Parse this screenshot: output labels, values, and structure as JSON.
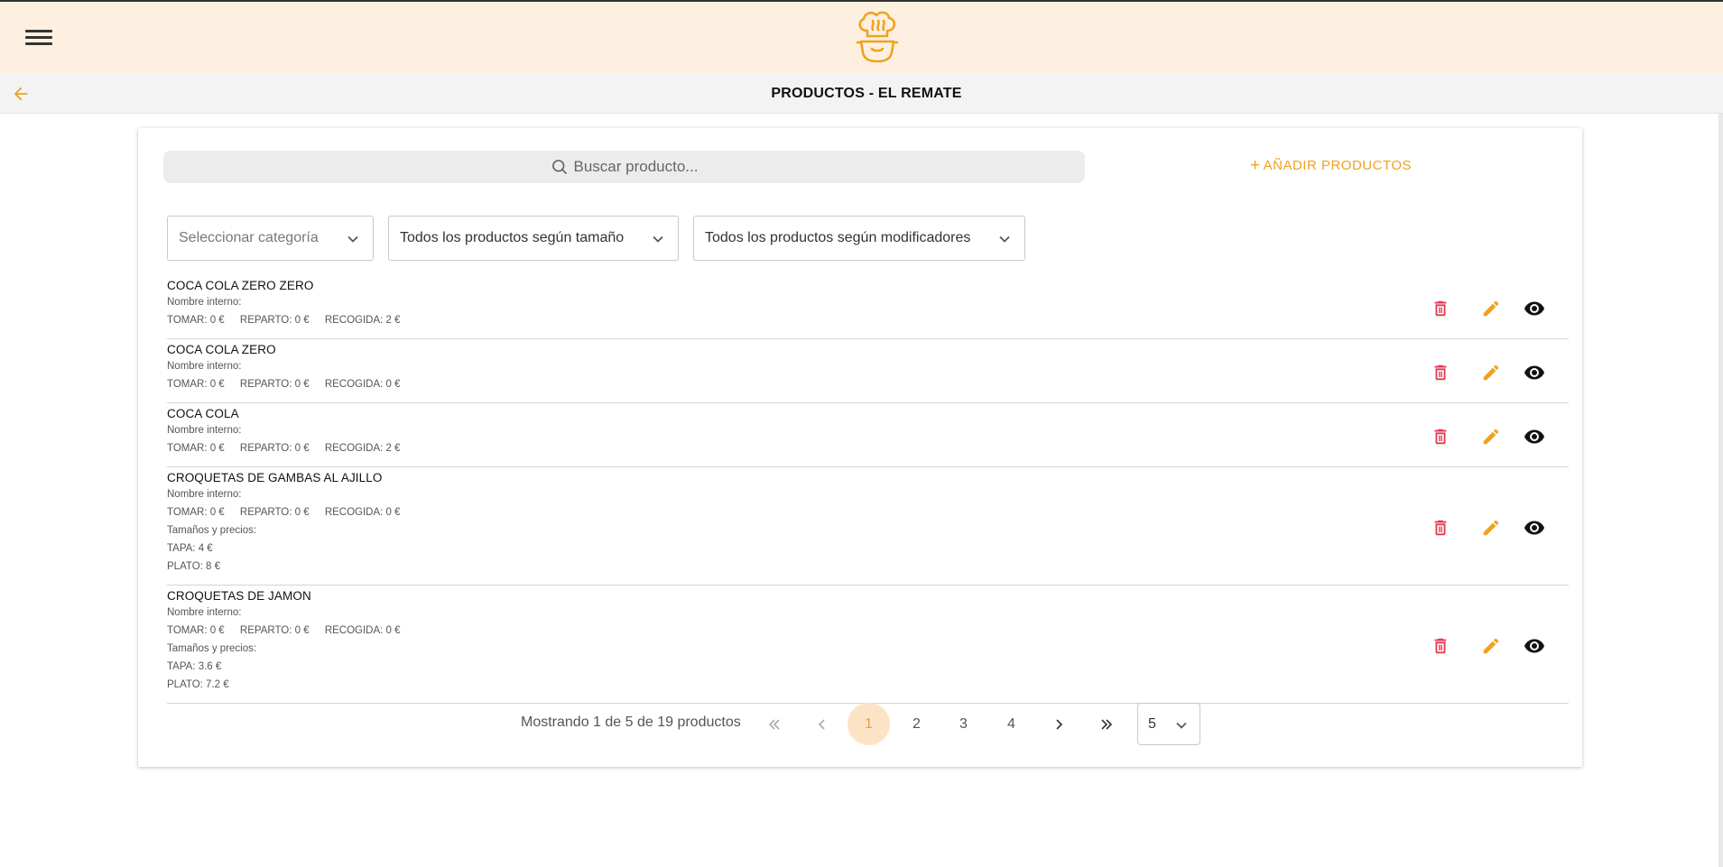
{
  "header": {
    "page_title": "PRODUCTOS - EL REMATE"
  },
  "search": {
    "placeholder": "Buscar producto..."
  },
  "add_button": {
    "label": "AÑADIR PRODUCTOS"
  },
  "filters": {
    "category": "Seleccionar categoría",
    "size": "Todos los productos según tamaño",
    "modifiers": "Todos los productos según modificadores"
  },
  "products": [
    {
      "name": "COCA COLA ZERO ZERO",
      "internal": "Nombre interno:",
      "tomar": "TOMAR: 0 €",
      "reparto": "REPARTO: 0 €",
      "recogida": "RECOGIDA: 2 €"
    },
    {
      "name": "COCA COLA ZERO",
      "internal": "Nombre interno:",
      "tomar": "TOMAR: 0 €",
      "reparto": "REPARTO: 0 €",
      "recogida": "RECOGIDA: 0 €"
    },
    {
      "name": "COCA COLA",
      "internal": "Nombre interno:",
      "tomar": "TOMAR: 0 €",
      "reparto": "REPARTO: 0 €",
      "recogida": "RECOGIDA: 2 €"
    },
    {
      "name": "CROQUETAS DE GAMBAS AL AJILLO",
      "internal": "Nombre interno:",
      "tomar": "TOMAR: 0 €",
      "reparto": "REPARTO: 0 €",
      "recogida": "RECOGIDA: 0 €",
      "sizes_label": "Tamaños y precios:",
      "sizes": [
        "TAPA: 4 €",
        "PLATO: 8 €"
      ]
    },
    {
      "name": "CROQUETAS DE JAMON",
      "internal": "Nombre interno:",
      "tomar": "TOMAR: 0 €",
      "reparto": "REPARTO: 0 €",
      "recogida": "RECOGIDA: 0 €",
      "sizes_label": "Tamaños y precios:",
      "sizes": [
        "TAPA: 3.6 €",
        "PLATO: 7.2 €"
      ]
    }
  ],
  "pagination": {
    "info": "Mostrando 1 de 5 de 19 productos",
    "pages": [
      "1",
      "2",
      "3",
      "4"
    ],
    "current": "1",
    "per_page": "5"
  },
  "colors": {
    "accent": "#f0a21e",
    "delete": "#e53950",
    "topbar": "#fdf0e0"
  }
}
